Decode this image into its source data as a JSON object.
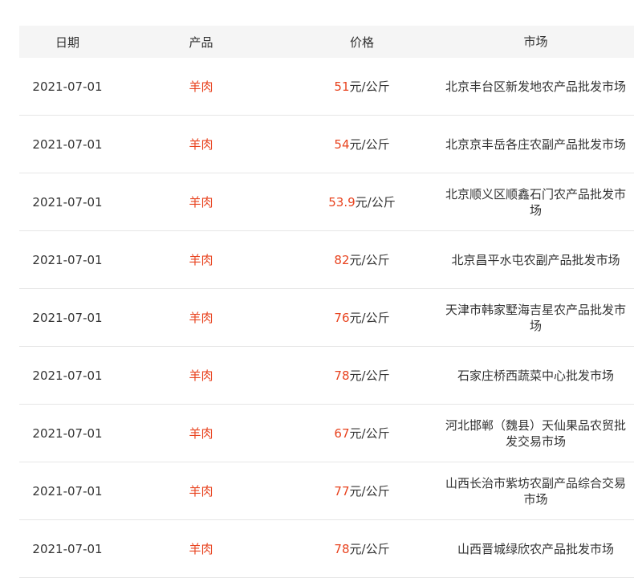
{
  "table": {
    "headers": [
      "日期",
      "产品",
      "价格",
      "市场"
    ],
    "rows": [
      {
        "date": "2021-07-01",
        "product": "羊肉",
        "price": "51",
        "unit": "元/公斤",
        "market": "北京丰台区新发地农产品批发市场"
      },
      {
        "date": "2021-07-01",
        "product": "羊肉",
        "price": "54",
        "unit": "元/公斤",
        "market": "北京京丰岳各庄农副产品批发市场"
      },
      {
        "date": "2021-07-01",
        "product": "羊肉",
        "price": "53.9",
        "unit": "元/公斤",
        "market": "北京顺义区顺鑫石门农产品批发市场"
      },
      {
        "date": "2021-07-01",
        "product": "羊肉",
        "price": "82",
        "unit": "元/公斤",
        "market": "北京昌平水屯农副产品批发市场"
      },
      {
        "date": "2021-07-01",
        "product": "羊肉",
        "price": "76",
        "unit": "元/公斤",
        "market": "天津市韩家墅海吉星农产品批发市场"
      },
      {
        "date": "2021-07-01",
        "product": "羊肉",
        "price": "78",
        "unit": "元/公斤",
        "market": "石家庄桥西蔬菜中心批发市场"
      },
      {
        "date": "2021-07-01",
        "product": "羊肉",
        "price": "67",
        "unit": "元/公斤",
        "market": "河北邯郸（魏县）天仙果品农贸批发交易市场"
      },
      {
        "date": "2021-07-01",
        "product": "羊肉",
        "price": "77",
        "unit": "元/公斤",
        "market": "山西长治市紫坊农副产品综合交易市场"
      },
      {
        "date": "2021-07-01",
        "product": "羊肉",
        "price": "78",
        "unit": "元/公斤",
        "market": "山西晋城绿欣农产品批发市场"
      }
    ]
  },
  "colors": {
    "accent": "#e8431f",
    "header_bg": "#f5f5f5",
    "border": "#e6e6e6",
    "text": "#333333"
  }
}
